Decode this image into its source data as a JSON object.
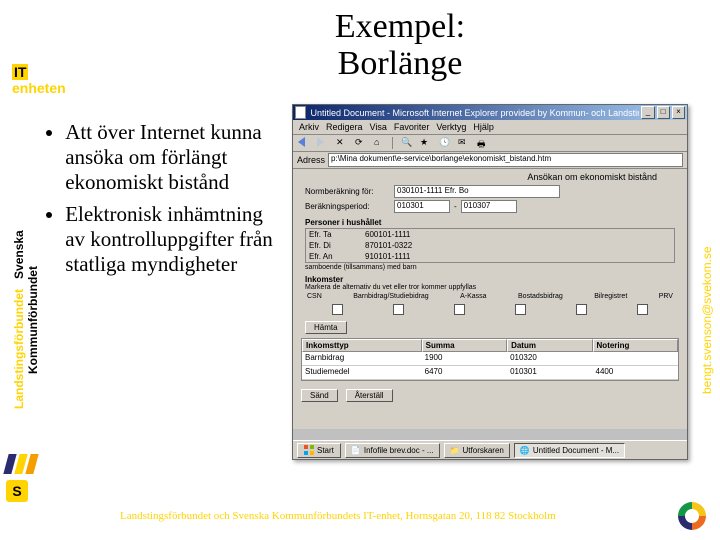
{
  "slide": {
    "title": "Exempel: Borlänge"
  },
  "top_left": {
    "it": "IT",
    "enheten": "enheten"
  },
  "sidebar": {
    "org1": "Svenska Kommunförbundet",
    "org2": "Landstingsförbundet"
  },
  "right_email": "bengt.svenson@svekom.se",
  "bullets": {
    "b1": "Att över Internet kunna ansöka om förlängt ekonomiskt bistånd",
    "b2": "Elektronisk inhämtning av kontrolluppgifter från statliga myndigheter"
  },
  "footer": "Landstingsförbundet och Svenska Kommunförbundets IT-enhet, Hornsgatan 20, 118 82 Stockholm",
  "app": {
    "titlebar": "Untitled Document - Microsoft Internet Explorer provided by Kommun- och Landstingsförbunden",
    "menu": {
      "m1": "Arkiv",
      "m2": "Redigera",
      "m3": "Visa",
      "m4": "Favoriter",
      "m5": "Verktyg",
      "m6": "Hjälp"
    },
    "address_label": "Adress",
    "address_value": "p:\\Mina dokument\\e-service\\borlange\\ekonomiskt_bistand.htm",
    "page_header": "Ansökan om ekonomiskt bistånd",
    "norm": {
      "label": "Normberäkning för:",
      "val": "030101-1111    Efr. Bo"
    },
    "period": {
      "label": "Beräkningsperiod:",
      "from": "010301",
      "to": "010307"
    },
    "pers_header": "Personer i hushållet",
    "pers_rows": {
      "r1c1": "Efr. Ta",
      "r1c2": "600101-1111",
      "r2c1": "Efr. Di",
      "r2c2": "870101-0322",
      "r3c1": "Efr. An",
      "r3c2": "910101-1111",
      "note": "samboende (tillsammans) med barn"
    },
    "ink_header": "Inkomster",
    "ink_sub": "Markera de alternativ du vet eller tror kommer uppfyllas",
    "cols": {
      "c1": "CSN",
      "c2": "Barnbidrag/Studiebidrag",
      "c3": "A-Kassa",
      "c4": "Bostadsbidrag",
      "c5": "Bilregistret",
      "c6": "PRV"
    },
    "btn_calc": "Hämta",
    "table": {
      "h1": "Inkomsttyp",
      "h2": "Summa",
      "h3": "Datum",
      "h4": "Notering",
      "r1c1": "Barnbidrag",
      "r1c2": "1900",
      "r1c3": "010320",
      "r1c4": "",
      "r2c1": "Studiemedel",
      "r2c2": "6470",
      "r2c3": "010301",
      "r2c4": "4400"
    },
    "btn_send": "Sänd",
    "btn_clear": "Återställ",
    "task": {
      "start": "Start",
      "t1": "Infofile brev.doc - ...",
      "t2": "Utforskaren",
      "t3": "Untitled Document - M..."
    }
  }
}
